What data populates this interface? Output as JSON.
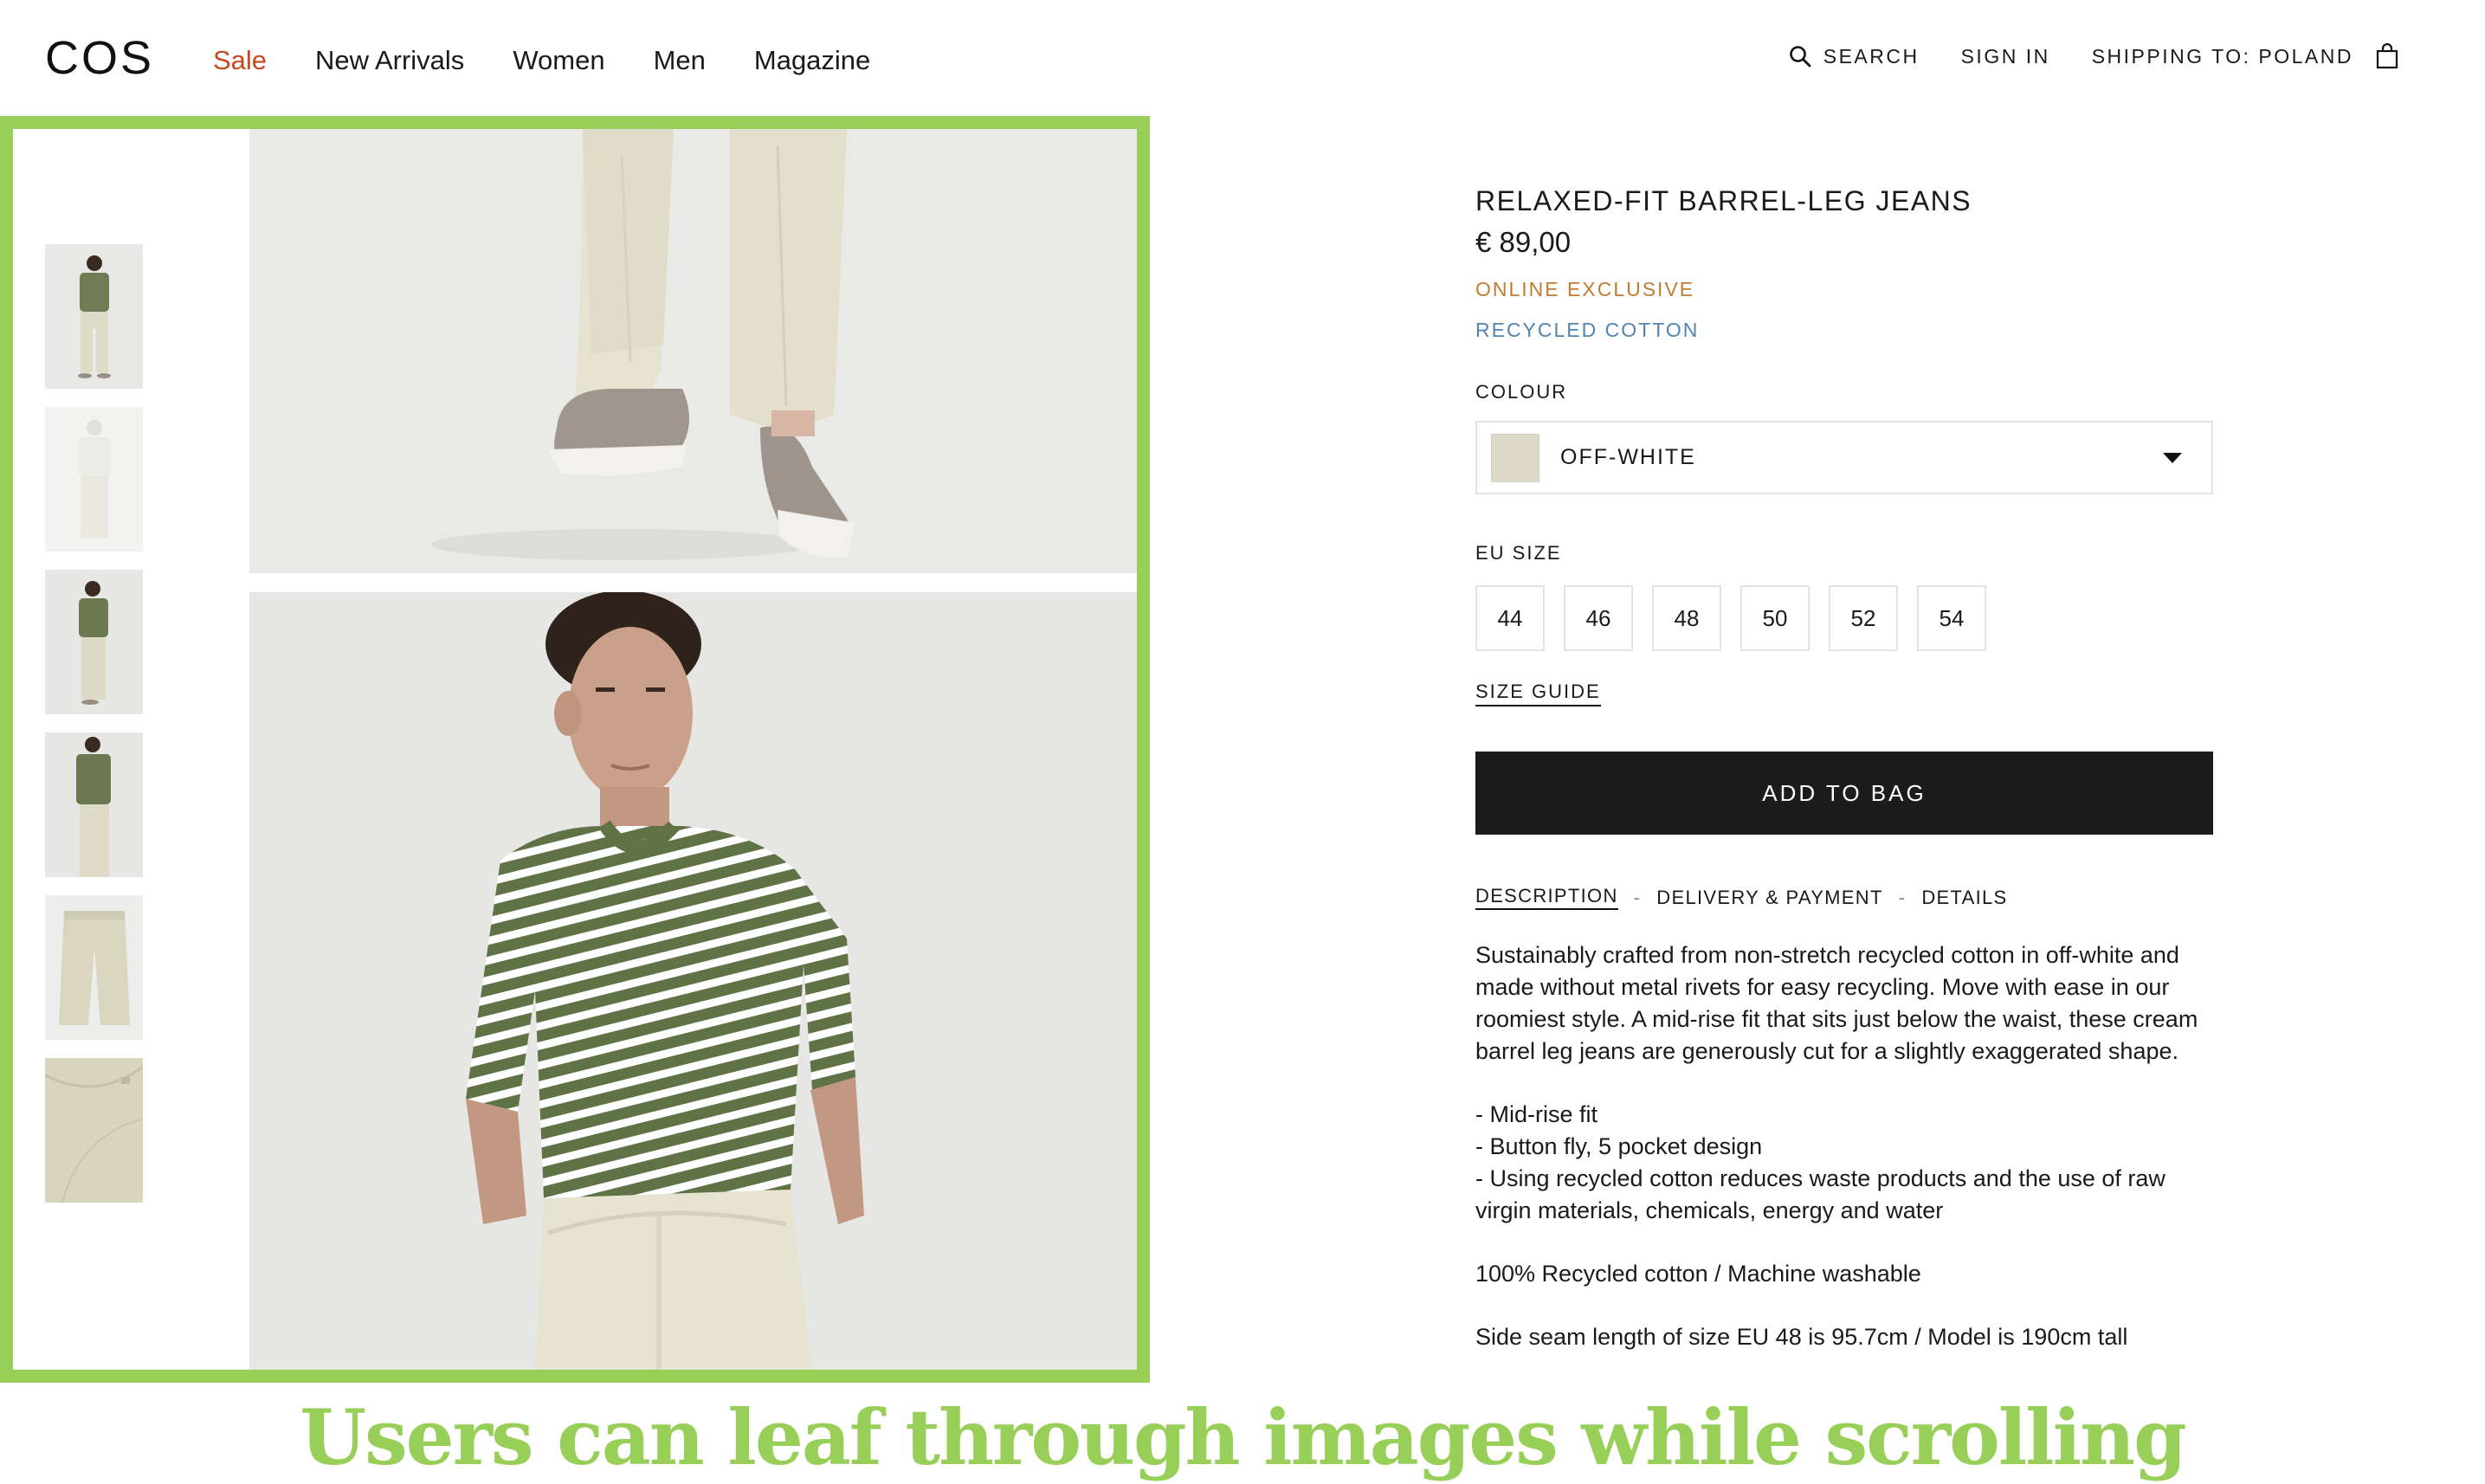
{
  "header": {
    "logo": "COS",
    "nav": [
      "Sale",
      "New Arrivals",
      "Women",
      "Men",
      "Magazine"
    ],
    "search_label": "SEARCH",
    "signin_label": "SIGN IN",
    "shipping_label": "SHIPPING TO: POLAND",
    "icons": [
      "search-icon",
      "shopping-bag-icon"
    ]
  },
  "gallery": {
    "thumbnail_count": 6,
    "highlight_color": "#98cf59"
  },
  "product": {
    "title": "RELAXED-FIT BARREL-LEG JEANS",
    "price": "€ 89,00",
    "tag_online": "ONLINE EXCLUSIVE",
    "tag_recycled": "RECYCLED COTTON",
    "colour_label": "COLOUR",
    "colour_value": "OFF-WHITE",
    "swatch_color": "#dcd9c9",
    "size_label": "EU SIZE",
    "sizes": [
      "44",
      "46",
      "48",
      "50",
      "52",
      "54"
    ],
    "size_guide": "SIZE GUIDE",
    "add_to_bag": "ADD TO BAG",
    "tabs": [
      "DESCRIPTION",
      "DELIVERY & PAYMENT",
      "DETAILS"
    ],
    "description": "Sustainably crafted from non-stretch recycled cotton in off-white and made without metal rivets for easy recycling. Move with ease in our roomiest style. A mid-rise fit that sits just below the waist, these cream barrel leg jeans are generously cut for a slightly exaggerated shape.",
    "bullets": [
      "- Mid-rise fit",
      "- Button fly, 5 pocket design",
      "- Using recycled cotton reduces waste products and the use of raw virgin materials, chemicals, energy and water"
    ],
    "composition": "100% Recycled cotton / Machine washable",
    "fit_note": "Side seam length of size EU 48 is 95.7cm / Model is 190cm tall"
  },
  "caption": "Users can leaf through images while scrolling"
}
